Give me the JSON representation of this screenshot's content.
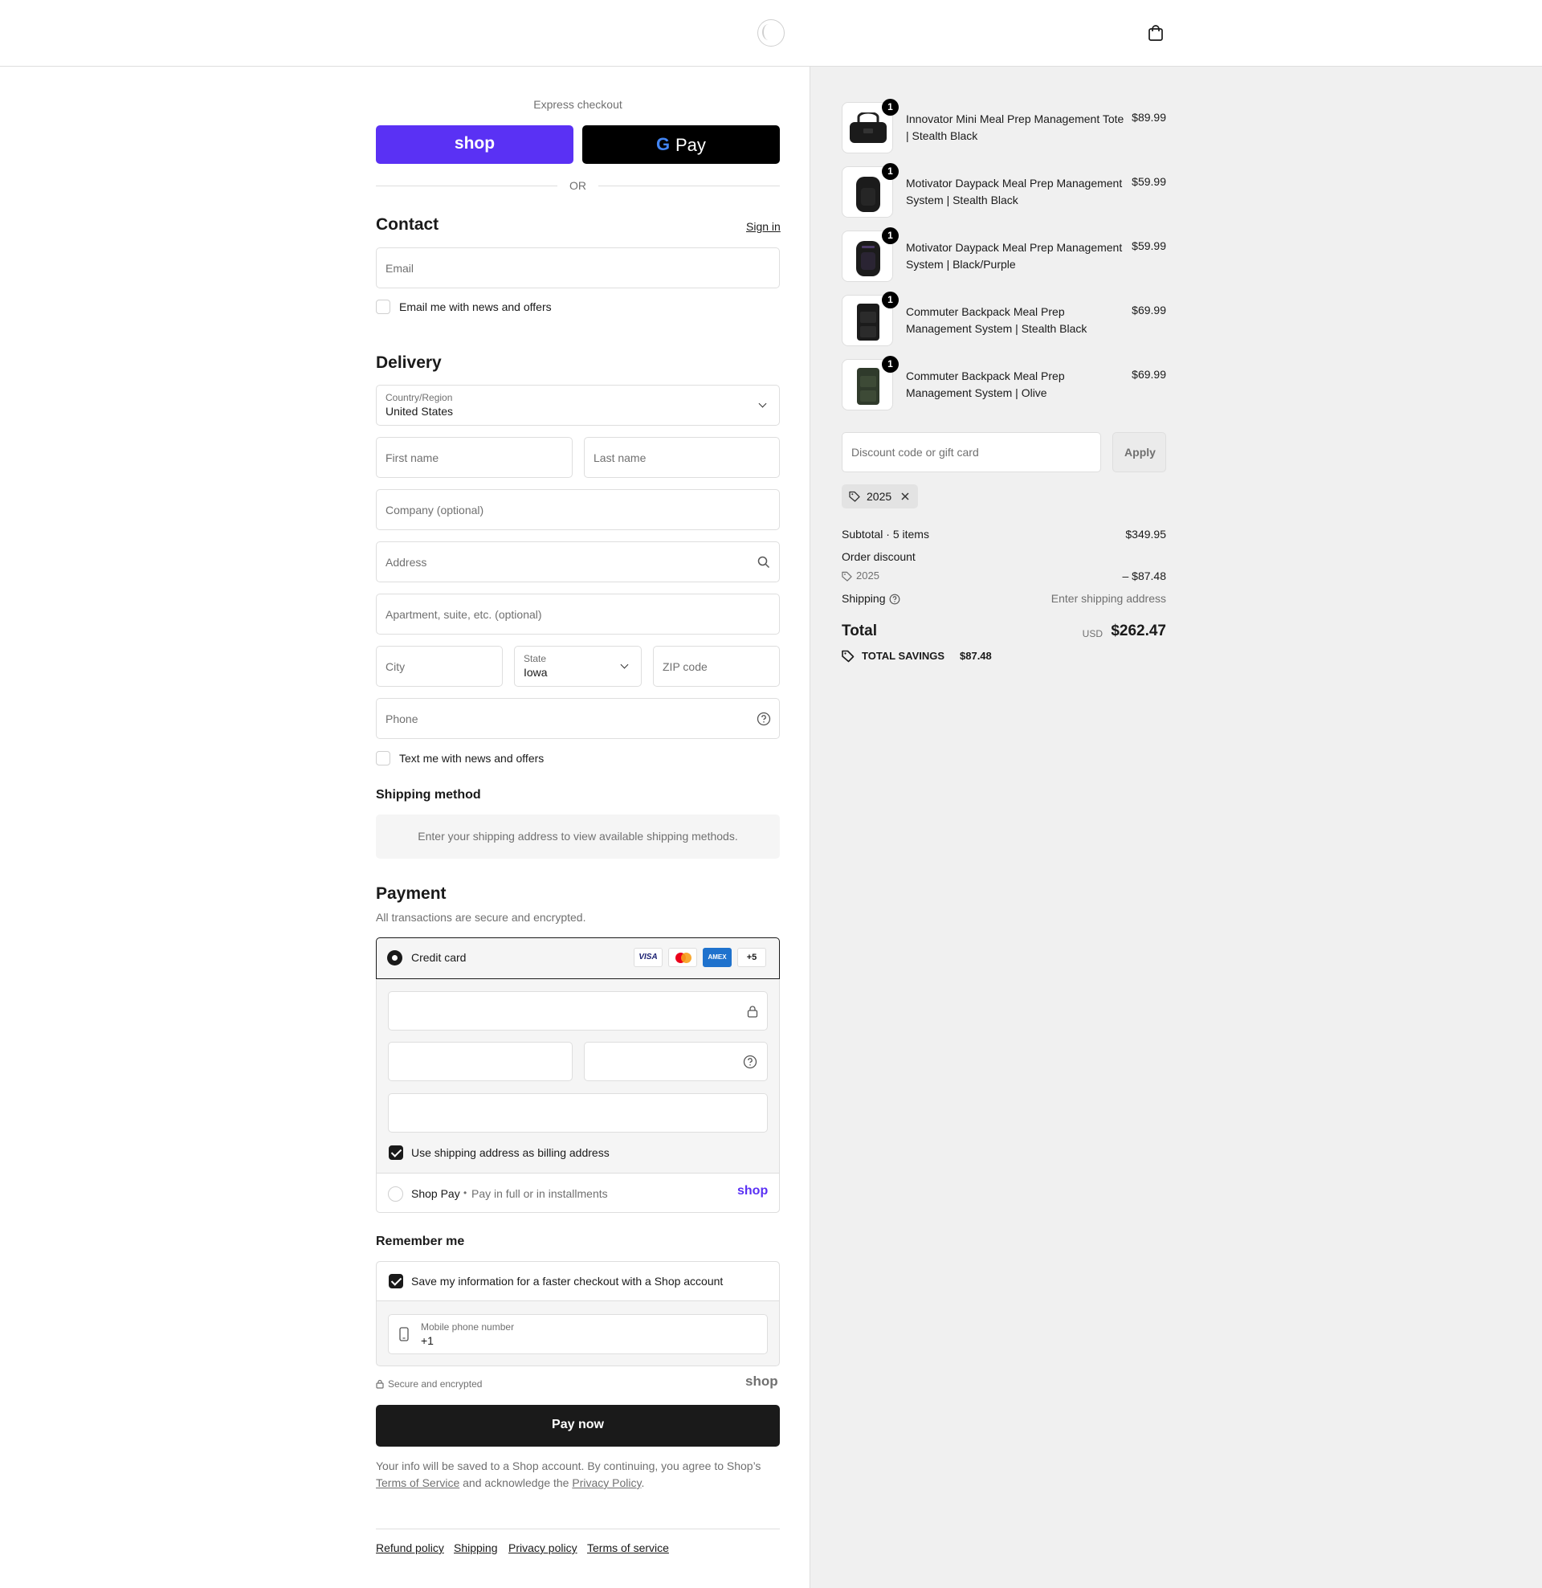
{
  "header": {
    "logo": "store-logo",
    "cart_icon": "bag-icon"
  },
  "express": {
    "title": "Express checkout",
    "shop_label": "shop",
    "gpay_g": "G",
    "gpay_label": "Pay",
    "or": "OR"
  },
  "contact": {
    "title": "Contact",
    "sign_in": "Sign in",
    "email_placeholder": "Email",
    "news_label": "Email me with news and offers"
  },
  "delivery": {
    "title": "Delivery",
    "country_label": "Country/Region",
    "country_value": "United States",
    "first_name": "First name",
    "last_name": "Last name",
    "company": "Company (optional)",
    "address": "Address",
    "apartment": "Apartment, suite, etc. (optional)",
    "city": "City",
    "state_label": "State",
    "state_value": "Iowa",
    "zip": "ZIP code",
    "phone": "Phone",
    "text_label": "Text me with news and offers"
  },
  "shipping_method": {
    "title": "Shipping method",
    "notice": "Enter your shipping address to view available shipping methods."
  },
  "payment": {
    "title": "Payment",
    "subtitle": "All transactions are secure and encrypted.",
    "credit_card": "Credit card",
    "cards": [
      "VISA",
      "",
      "AMEX",
      "+5"
    ],
    "billing_label": "Use shipping address as billing address",
    "shop_pay": "Shop Pay",
    "shop_pay_dot": "•",
    "shop_pay_desc": "Pay in full or in installments",
    "shop_logo": "shop"
  },
  "remember": {
    "title": "Remember me",
    "save_label": "Save my information for a faster checkout with a Shop account",
    "mobile_label": "Mobile phone number",
    "mobile_value": "+1",
    "secure": "Secure and encrypted",
    "shop_logo": "shop"
  },
  "pay_now": "Pay now",
  "legal": {
    "part1": "Your info will be saved to a Shop account. By continuing, you agree to Shop’s",
    "tos": "Terms of Service",
    "part2": "and acknowledge the",
    "privacy": "Privacy Policy",
    "part3": "."
  },
  "footer": [
    "Refund policy",
    "Shipping",
    "Privacy policy",
    "Terms of service"
  ],
  "cart": {
    "items": [
      {
        "qty": "1",
        "line1": "Innovator Mini Meal Prep Management Tote",
        "line2": "| Stealth Black",
        "price": "$89.99"
      },
      {
        "qty": "1",
        "line1": "Motivator Daypack Meal Prep Management",
        "line2": "System | Stealth Black",
        "price": "$59.99"
      },
      {
        "qty": "1",
        "line1": "Motivator Daypack Meal Prep Management",
        "line2": "System | Black/Purple",
        "price": "$59.99"
      },
      {
        "qty": "1",
        "line1": "Commuter Backpack Meal Prep",
        "line2": "Management System | Stealth Black",
        "price": "$69.99"
      },
      {
        "qty": "1",
        "line1": "Commuter Backpack Meal Prep",
        "line2": "Management System | Olive",
        "price": "$69.99"
      }
    ],
    "discount_placeholder": "Discount code or gift card",
    "apply": "Apply",
    "applied_code": "2025"
  },
  "summary": {
    "subtotal_label": "Subtotal · 5 items",
    "subtotal_value": "$349.95",
    "order_discount": "Order discount",
    "discount_code": "2025",
    "discount_value": "– $87.48",
    "shipping_label": "Shipping",
    "shipping_value": "Enter shipping address",
    "total_label": "Total",
    "currency": "USD",
    "total_value": "$262.47",
    "savings_label": "TOTAL SAVINGS",
    "savings_value": "$87.48"
  },
  "colors": {
    "shop_purple": "#5a31f4",
    "dark": "#1a1a1a",
    "panel": "#f0f0f0",
    "amex": "#1f72cd"
  }
}
